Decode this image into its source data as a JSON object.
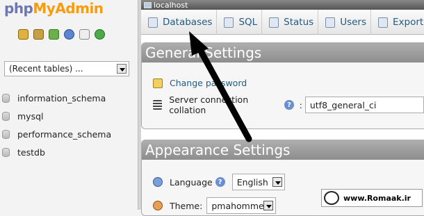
{
  "nav": {
    "logo": {
      "part1": "php",
      "part2": "MyAdmin"
    },
    "icons": [
      "home-icon",
      "exit-icon",
      "query-icon",
      "help-icon",
      "docs-icon",
      "reload-icon"
    ],
    "recent_tables": "(Recent tables) ...",
    "databases": [
      "information_schema",
      "mysql",
      "performance_schema",
      "testdb"
    ]
  },
  "server_bar": {
    "label": "localhost"
  },
  "tabs": [
    {
      "label": "Databases",
      "icon": "database-icon"
    },
    {
      "label": "SQL",
      "icon": "sql-icon"
    },
    {
      "label": "Status",
      "icon": "status-icon"
    },
    {
      "label": "Users",
      "icon": "users-icon"
    },
    {
      "label": "Export",
      "icon": "export-icon"
    }
  ],
  "general": {
    "title": "General Settings",
    "change_password": "Change password",
    "collation_label": "Server connection collation",
    "collation_value": "utf8_general_ci",
    "help_mark": "?",
    "colon": ":"
  },
  "appearance": {
    "title": "Appearance Settings",
    "language_label": "Language",
    "language_value": "English",
    "theme_label": "Theme:",
    "theme_value": "pmahomme"
  },
  "watermark": "www.Romaak.ir",
  "colors": {
    "link": "#235a81",
    "logo_php": "#6c78af",
    "logo_admin": "#f89c0e",
    "panel_header": "#9a9a9a"
  }
}
